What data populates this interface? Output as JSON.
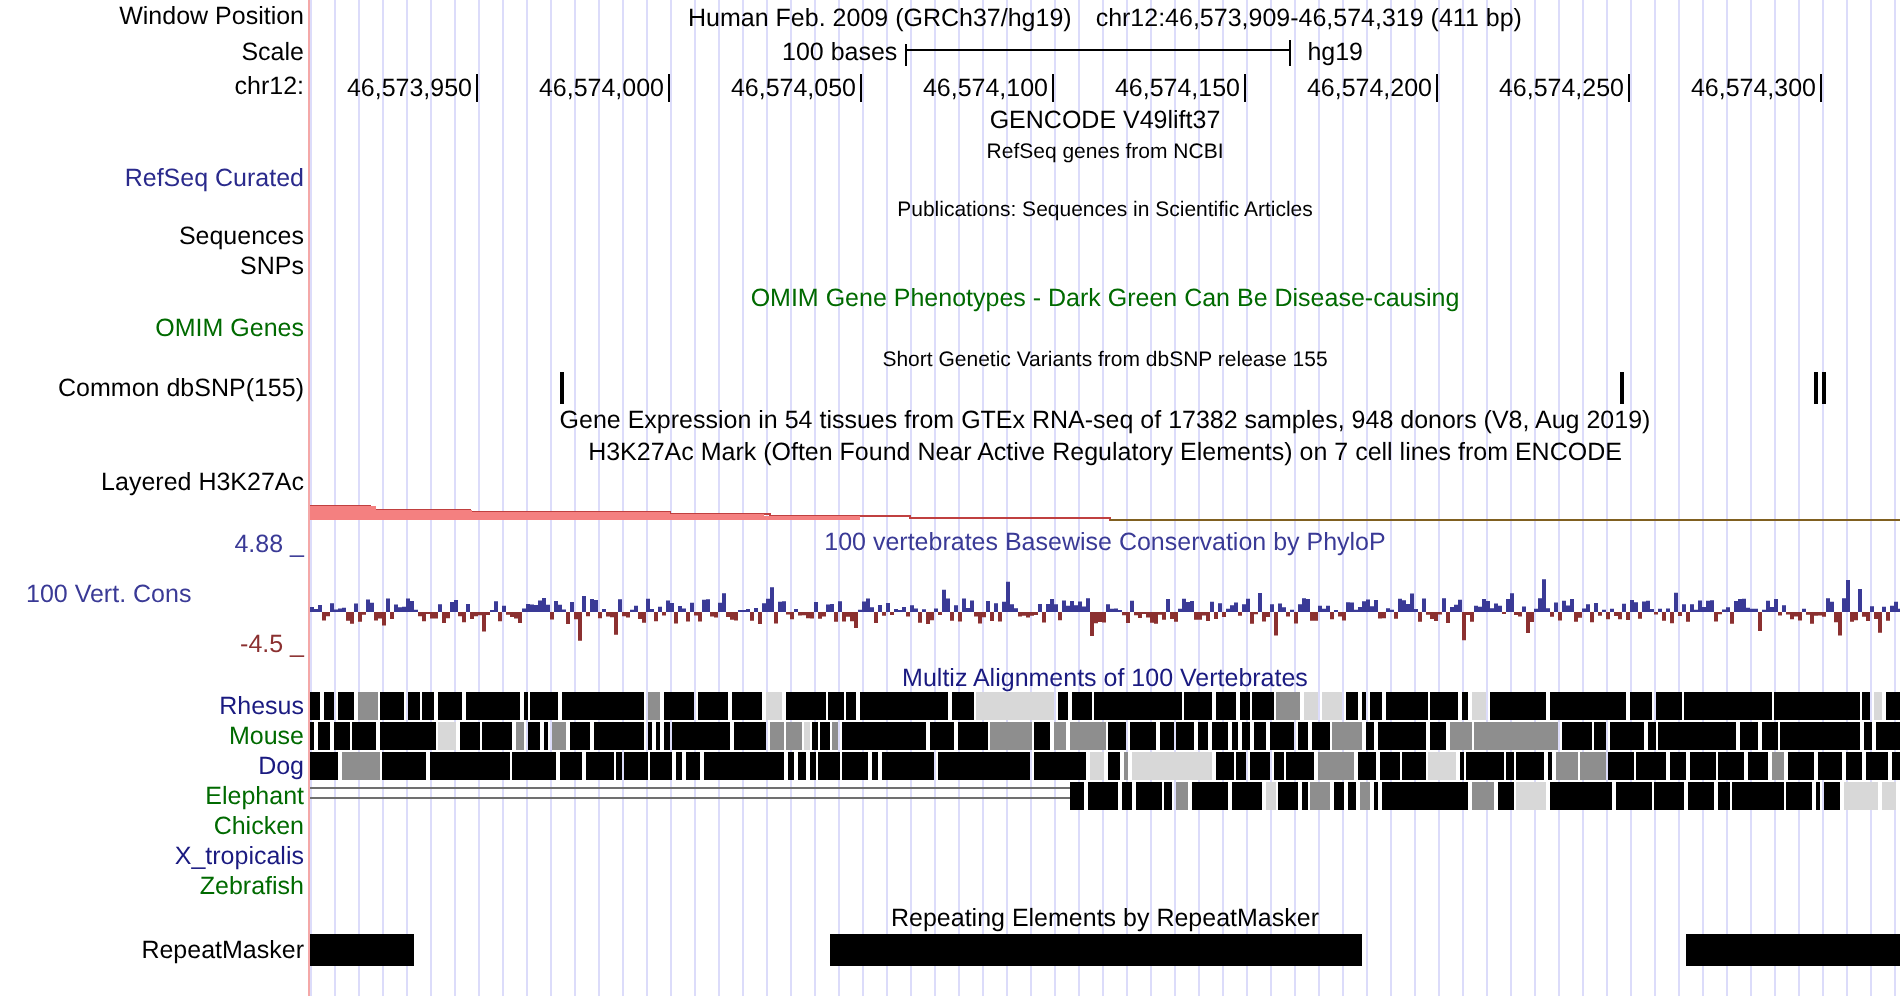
{
  "header": {
    "label": "Window Position",
    "assembly": "Human Feb. 2009 (GRCh37/hg19)",
    "position": "chr12:46,573,909-46,574,319 (411 bp)"
  },
  "scale": {
    "label": "Scale",
    "length": "100 bases",
    "assembly": "hg19"
  },
  "ruler": {
    "label": "chr12:",
    "ticks": [
      "46,573,950",
      "46,574,000",
      "46,574,050",
      "46,574,100",
      "46,574,150",
      "46,574,200",
      "46,574,250",
      "46,574,300"
    ]
  },
  "tracks": [
    {
      "kind": "title",
      "text": "GENCODE V49lift37",
      "color": "#000000"
    },
    {
      "kind": "note",
      "text": "RefSeq genes from NCBI",
      "color": "#000000"
    },
    {
      "kind": "empty",
      "label": "RefSeq Curated",
      "color": "#2a2a8c"
    },
    {
      "kind": "note",
      "text": "Publications: Sequences in Scientific Articles",
      "color": "#000000"
    },
    {
      "kind": "empty",
      "label": "Sequences",
      "color": "#000000"
    },
    {
      "kind": "empty",
      "label": "SNPs",
      "color": "#000000"
    },
    {
      "kind": "title",
      "text": "OMIM Gene Phenotypes - Dark Green Can Be Disease-causing",
      "color": "#006a00"
    },
    {
      "kind": "empty",
      "label": "OMIM Genes",
      "color": "#006a00"
    },
    {
      "kind": "note",
      "text": "Short Genetic Variants from dbSNP release 155",
      "color": "#000000"
    },
    {
      "kind": "snps",
      "label": "Common dbSNP(155)",
      "color": "#000000"
    },
    {
      "kind": "title",
      "text": "Gene Expression in 54 tissues from GTEx RNA-seq of 17382 samples, 948 donors (V8, Aug 2019)",
      "color": "#000000"
    },
    {
      "kind": "title",
      "text": "H3K27Ac Mark (Often Found Near Active Regulatory Elements) on 7 cell lines from ENCODE",
      "color": "#000000"
    },
    {
      "kind": "layered",
      "label": "Layered H3K27Ac",
      "color": "#000000"
    }
  ],
  "conservation": {
    "title": "100 vertebrates Basewise Conservation by PhyloP",
    "label": "100 Vert. Cons",
    "max": "4.88 _",
    "min": "-4.5 _"
  },
  "multiz": {
    "title": "Multiz Alignments of 100 Vertebrates",
    "species": [
      {
        "name": "Rhesus",
        "color": "#1a1a80",
        "kind": "aligned"
      },
      {
        "name": "Mouse",
        "color": "#006a00",
        "kind": "aligned"
      },
      {
        "name": "Dog",
        "color": "#1a1a80",
        "kind": "aligned"
      },
      {
        "name": "Elephant",
        "color": "#006a00",
        "kind": "partial"
      },
      {
        "name": "Chicken",
        "color": "#006a00",
        "kind": "none"
      },
      {
        "name": "X_tropicalis",
        "color": "#1a1a80",
        "kind": "none"
      },
      {
        "name": "Zebrafish",
        "color": "#006a00",
        "kind": "none"
      }
    ]
  },
  "repeats": {
    "title": "Repeating Elements by RepeatMasker",
    "label": "RepeatMasker"
  }
}
